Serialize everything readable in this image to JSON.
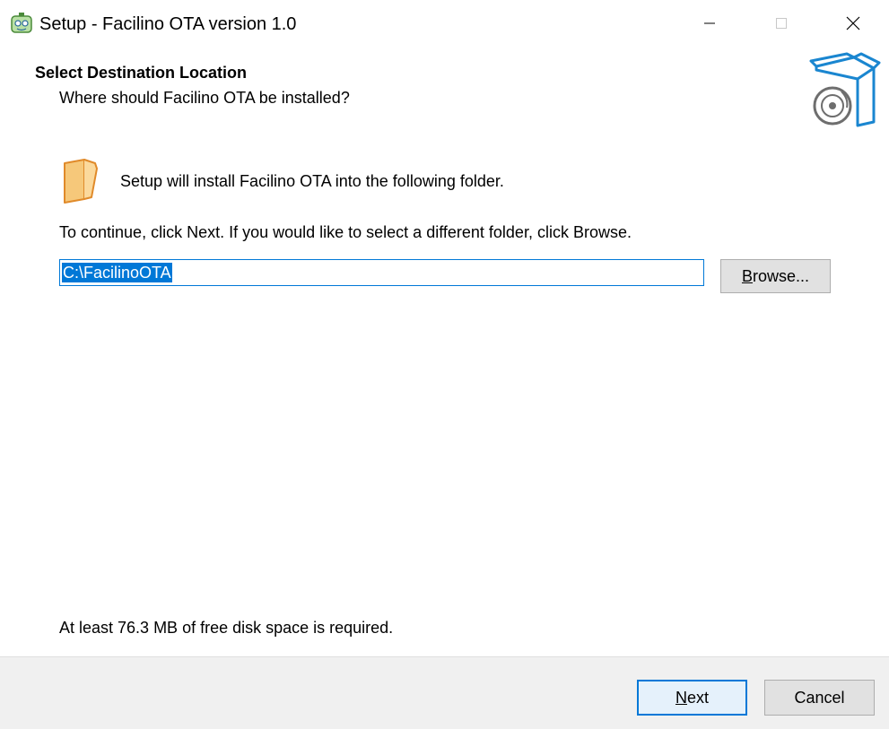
{
  "window": {
    "title": "Setup - Facilino OTA version 1.0",
    "icon": "robot-app-icon"
  },
  "header": {
    "title": "Select Destination Location",
    "subtitle": "Where should Facilino OTA be installed?",
    "image": "setup-box-disc-icon"
  },
  "body": {
    "folder_icon": "folder-icon",
    "install_text": "Setup will install Facilino OTA into the following folder.",
    "continue_text": "To continue, click Next. If you would like to select a different folder, click Browse.",
    "path_value": "C:\\FacilinoOTA",
    "browse_label_accel": "B",
    "browse_label_rest": "rowse...",
    "disk_space_text": "At least 76.3 MB of free disk space is required."
  },
  "footer": {
    "next_label_accel": "N",
    "next_label_rest": "ext",
    "cancel_label": "Cancel"
  },
  "colors": {
    "accent": "#0078d7",
    "footer_bg": "#f0f0f0",
    "button_bg": "#e1e1e1",
    "folder": "#f0a84a",
    "box_blue": "#1a86d0"
  }
}
